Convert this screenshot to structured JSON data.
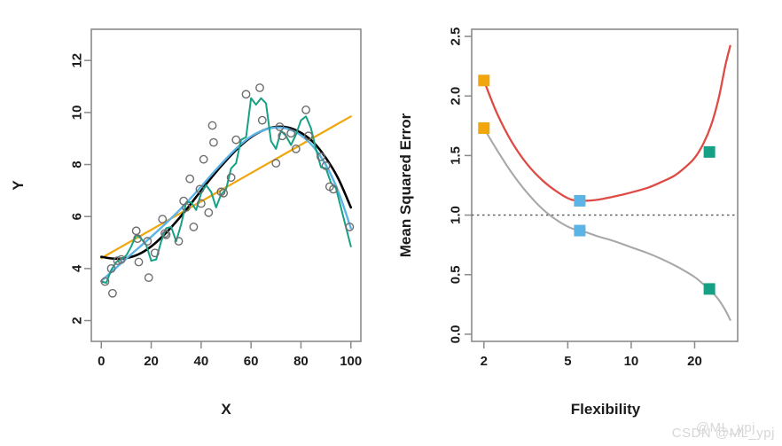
{
  "figure": {
    "watermark": "CSDN @ML_ypj",
    "watermark_overlay": "@ML_ypj"
  },
  "chart_data": [
    {
      "id": "left",
      "type": "scatter",
      "title": "",
      "xlabel": "X",
      "ylabel": "Y",
      "xlim": [
        -4,
        104
      ],
      "ylim": [
        1.2,
        13.2
      ],
      "xticks": [
        0,
        20,
        40,
        60,
        80,
        100
      ],
      "yticks": [
        2,
        4,
        6,
        8,
        10,
        12
      ],
      "grid": false,
      "legend": "none",
      "points": [
        [
          1.5,
          3.5
        ],
        [
          4.0,
          4.0
        ],
        [
          4.5,
          3.05
        ],
        [
          6.5,
          4.3
        ],
        [
          8.0,
          4.35
        ],
        [
          14.0,
          5.45
        ],
        [
          14.5,
          5.15
        ],
        [
          15.0,
          4.25
        ],
        [
          18.5,
          5.05
        ],
        [
          19.0,
          3.65
        ],
        [
          21.5,
          4.6
        ],
        [
          24.5,
          5.9
        ],
        [
          25.5,
          5.35
        ],
        [
          26.0,
          5.3
        ],
        [
          31.0,
          5.05
        ],
        [
          33.0,
          6.6
        ],
        [
          34.0,
          6.35
        ],
        [
          35.5,
          7.45
        ],
        [
          37.0,
          5.6
        ],
        [
          39.5,
          7.05
        ],
        [
          40.0,
          6.5
        ],
        [
          41.0,
          8.2
        ],
        [
          43.0,
          6.15
        ],
        [
          44.5,
          9.5
        ],
        [
          45.0,
          8.85
        ],
        [
          48.0,
          6.95
        ],
        [
          49.0,
          6.9
        ],
        [
          52.0,
          7.5
        ],
        [
          54.0,
          8.95
        ],
        [
          58.0,
          10.7
        ],
        [
          63.5,
          10.95
        ],
        [
          64.5,
          9.7
        ],
        [
          70.0,
          8.05
        ],
        [
          71.5,
          9.45
        ],
        [
          72.5,
          9.1
        ],
        [
          76.0,
          9.2
        ],
        [
          78.0,
          8.6
        ],
        [
          82.0,
          10.1
        ],
        [
          83.0,
          9.1
        ],
        [
          88.0,
          8.3
        ],
        [
          90.0,
          7.95
        ],
        [
          91.5,
          7.15
        ],
        [
          93.0,
          7.05
        ],
        [
          99.5,
          5.6
        ]
      ],
      "series": [
        {
          "name": "linear-fit",
          "color": "#F0A60C",
          "width": 2.2,
          "kind": "linear",
          "x": [
            0,
            100
          ],
          "y": [
            4.4,
            9.85
          ]
        },
        {
          "name": "smooth-spline-low-flex",
          "color": "#000000",
          "width": 2.6,
          "kind": "smooth",
          "x": [
            0,
            5,
            10,
            15,
            20,
            25,
            30,
            35,
            40,
            45,
            50,
            55,
            60,
            65,
            70,
            75,
            80,
            85,
            90,
            95,
            100
          ],
          "y": [
            4.45,
            4.38,
            4.4,
            4.55,
            4.85,
            5.28,
            5.8,
            6.38,
            7.0,
            7.6,
            8.15,
            8.65,
            9.05,
            9.32,
            9.45,
            9.42,
            9.22,
            8.85,
            8.25,
            7.45,
            6.35
          ]
        },
        {
          "name": "smooth-spline-mid-flex",
          "color": "#5BB4E5",
          "width": 2.4,
          "kind": "smooth",
          "x": [
            0,
            5,
            10,
            15,
            20,
            25,
            30,
            35,
            40,
            45,
            50,
            55,
            60,
            65,
            70,
            75,
            80,
            85,
            90,
            95,
            100
          ],
          "y": [
            3.52,
            3.95,
            4.38,
            4.8,
            5.22,
            5.66,
            6.12,
            6.62,
            7.15,
            7.7,
            8.22,
            8.7,
            9.08,
            9.32,
            9.42,
            9.36,
            9.12,
            8.68,
            7.98,
            6.95,
            5.55
          ]
        },
        {
          "name": "smooth-spline-high-flex",
          "color": "#16A085",
          "width": 2.0,
          "kind": "wiggly",
          "x": [
            0,
            2,
            4,
            6,
            8,
            10,
            12,
            14,
            16,
            18,
            20,
            22,
            24,
            26,
            28,
            30,
            32,
            34,
            36,
            38,
            40,
            42,
            44,
            46,
            48,
            50,
            52,
            54,
            56,
            58,
            60,
            62,
            64,
            66,
            68,
            70,
            72,
            74,
            76,
            78,
            80,
            82,
            84,
            86,
            88,
            90,
            92,
            94,
            96,
            98,
            100
          ],
          "y": [
            3.5,
            3.45,
            3.95,
            4.25,
            4.35,
            4.5,
            4.85,
            5.3,
            5.15,
            4.9,
            4.3,
            4.35,
            5.05,
            5.55,
            5.6,
            5.05,
            5.7,
            6.55,
            6.55,
            6.25,
            6.9,
            7.2,
            6.95,
            6.35,
            6.85,
            7.05,
            7.85,
            8.05,
            8.95,
            9.05,
            10.55,
            10.3,
            10.55,
            10.35,
            8.9,
            8.6,
            9.3,
            9.1,
            8.75,
            9.15,
            9.7,
            9.85,
            9.4,
            8.6,
            7.9,
            7.85,
            7.3,
            7.1,
            6.35,
            5.6,
            4.85
          ]
        }
      ]
    },
    {
      "id": "right",
      "type": "line",
      "title": "",
      "xlabel": "Flexibility",
      "ylabel": "Mean Squared Error",
      "xscale": "log",
      "xlim": [
        1.75,
        32
      ],
      "ylim": [
        -0.06,
        2.56
      ],
      "xticks": [
        2,
        5,
        10,
        20
      ],
      "yticks": [
        "0.0",
        "0.5",
        "1.0",
        "1.5",
        "2.0",
        "2.5"
      ],
      "ytick_values": [
        0.0,
        0.5,
        1.0,
        1.5,
        2.0,
        2.5
      ],
      "grid": false,
      "legend": "none",
      "hline": {
        "name": "irreducible-error",
        "value": 1.0,
        "color": "#555555",
        "style": "dotted"
      },
      "series": [
        {
          "name": "test-mse",
          "color": "#DD4B44",
          "width": 2.3,
          "x": [
            2,
            2.3,
            2.7,
            3.2,
            3.8,
            4.5,
            5.2,
            6,
            7,
            8,
            9,
            10,
            12,
            14,
            16,
            18,
            20,
            22,
            24,
            26,
            28,
            29.5
          ],
          "y": [
            2.13,
            1.86,
            1.62,
            1.43,
            1.29,
            1.19,
            1.13,
            1.12,
            1.13,
            1.15,
            1.17,
            1.19,
            1.23,
            1.28,
            1.33,
            1.4,
            1.48,
            1.6,
            1.76,
            1.98,
            2.26,
            2.42
          ]
        },
        {
          "name": "training-mse",
          "color": "#A8A8A8",
          "width": 2.1,
          "x": [
            2,
            2.3,
            2.7,
            3.2,
            3.8,
            4.5,
            5.2,
            6,
            7,
            8,
            9,
            10,
            12,
            14,
            16,
            18,
            20,
            22,
            24,
            26,
            28,
            29.5
          ],
          "y": [
            1.73,
            1.55,
            1.36,
            1.19,
            1.05,
            0.95,
            0.89,
            0.86,
            0.82,
            0.79,
            0.76,
            0.73,
            0.68,
            0.63,
            0.58,
            0.53,
            0.48,
            0.42,
            0.36,
            0.29,
            0.2,
            0.12
          ]
        }
      ],
      "markers": [
        {
          "name": "linear-fit-test-mse",
          "x": 2,
          "y": 2.13,
          "color": "#F0A60C",
          "series": "test-mse"
        },
        {
          "name": "linear-fit-train-mse",
          "x": 2,
          "y": 1.73,
          "color": "#F0A60C",
          "series": "training-mse"
        },
        {
          "name": "mid-flex-test-mse",
          "x": 5.7,
          "y": 1.12,
          "color": "#5BB4E5",
          "series": "test-mse"
        },
        {
          "name": "mid-flex-train-mse",
          "x": 5.7,
          "y": 0.87,
          "color": "#5BB4E5",
          "series": "training-mse"
        },
        {
          "name": "high-flex-test-mse",
          "x": 23.5,
          "y": 1.53,
          "color": "#16A085",
          "series": "test-mse"
        },
        {
          "name": "high-flex-train-mse",
          "x": 23.5,
          "y": 0.38,
          "color": "#16A085",
          "series": "training-mse"
        }
      ]
    }
  ]
}
